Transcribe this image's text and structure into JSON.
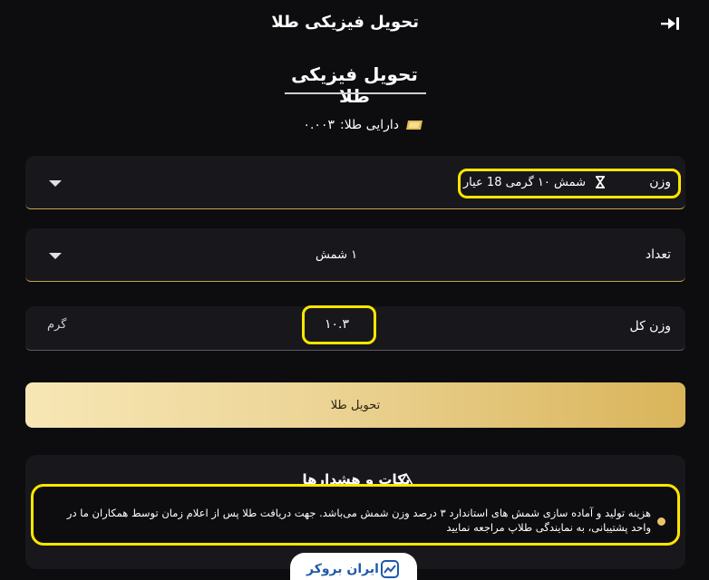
{
  "header": {
    "title": "تحویل فیزیکی طلا"
  },
  "page": {
    "title": "تحویل فیزیکی طلا"
  },
  "balance": {
    "label": "دارایی طلا:",
    "value": "۰.۰۰۳"
  },
  "form": {
    "weight": {
      "label": "وزن",
      "value": "شمش ۱۰ گرمی 18 عیار"
    },
    "count": {
      "label": "تعداد",
      "value": "۱ شمش"
    },
    "total": {
      "label": "وزن کل",
      "value": "۱۰.۳",
      "unit": "گرم"
    }
  },
  "submit": {
    "label": "تحویل طلا"
  },
  "notes": {
    "title": "نکات و هشدارها",
    "items": [
      "هزینه تولید و آماده سازی شمش های استاندارد ۳ درصد وزن شمش می‌باشد. جهت دریافت طلا پس از اعلام زمان توسط همکاران ما در واحد پشتیبانی، به  نمایندگی طلاپ مراجعه نمایید"
    ]
  },
  "watermark": {
    "text": "ایران بروکر"
  },
  "colors": {
    "accent": "#c7a24d",
    "highlight": "#ffe600",
    "background": "#0d0d0f",
    "card": "#18181c"
  },
  "icons": {
    "logout": "logout-icon",
    "gold": "gold-bar-icon",
    "hourglass": "hourglass-icon",
    "warning": "warning-icon",
    "dropdown": "chevron-down-icon"
  }
}
